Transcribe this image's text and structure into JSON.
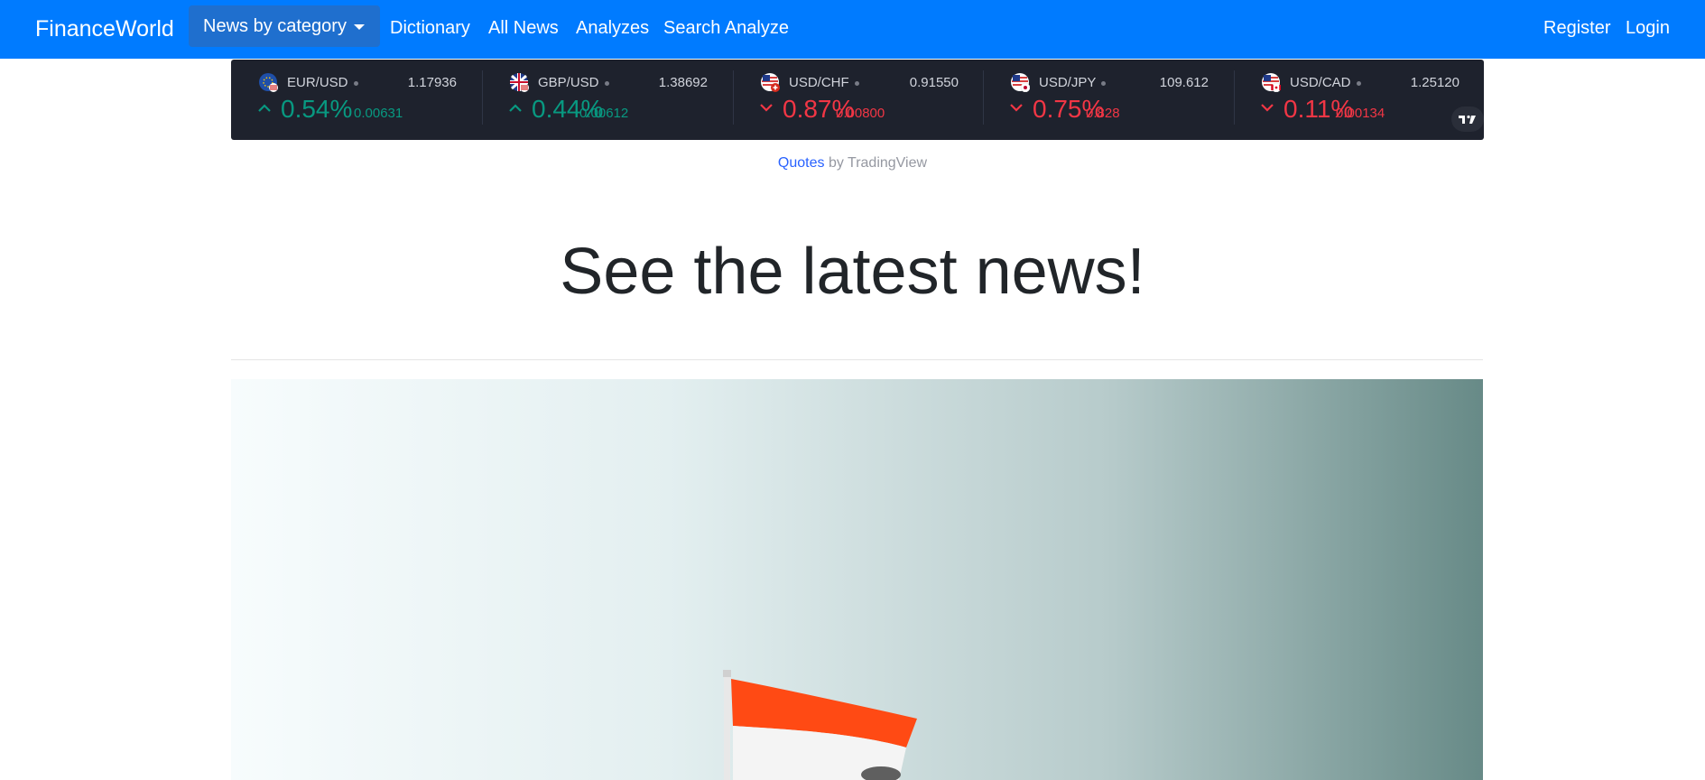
{
  "navbar": {
    "brand": "FinanceWorld",
    "dropdown_label": "News by category",
    "links": [
      "Dictionary",
      "All News",
      "Analyzes",
      "Search Analyze"
    ],
    "register": "Register",
    "login": "Login",
    "bg_color": "#007bff"
  },
  "ticker": {
    "items": [
      {
        "pair": "EUR/USD",
        "price": "1.17936",
        "pct": "0.54%",
        "chg": "0.00631",
        "dir": "up",
        "flag": "eu-us-flag-icon"
      },
      {
        "pair": "GBP/USD",
        "price": "1.38692",
        "pct": "0.44%",
        "chg": "0.00612",
        "dir": "up",
        "flag": "gb-us-flag-icon"
      },
      {
        "pair": "USD/CHF",
        "price": "0.91550",
        "pct": "0.87%",
        "chg": "0.00800",
        "dir": "down",
        "flag": "us-ch-flag-icon"
      },
      {
        "pair": "USD/JPY",
        "price": "109.612",
        "pct": "0.75%",
        "chg": "0.828",
        "dir": "down",
        "flag": "us-jp-flag-icon"
      },
      {
        "pair": "USD/CAD",
        "price": "1.25120",
        "pct": "0.11%",
        "chg": "0.00134",
        "dir": "down",
        "flag": "us-ca-flag-icon"
      }
    ],
    "up_color": "#089981",
    "down_color": "#f23645"
  },
  "caption": {
    "link": "Quotes",
    "rest": " by TradingView"
  },
  "headline": "See the latest news!",
  "hero": {
    "image": "indian-flag-photo"
  }
}
